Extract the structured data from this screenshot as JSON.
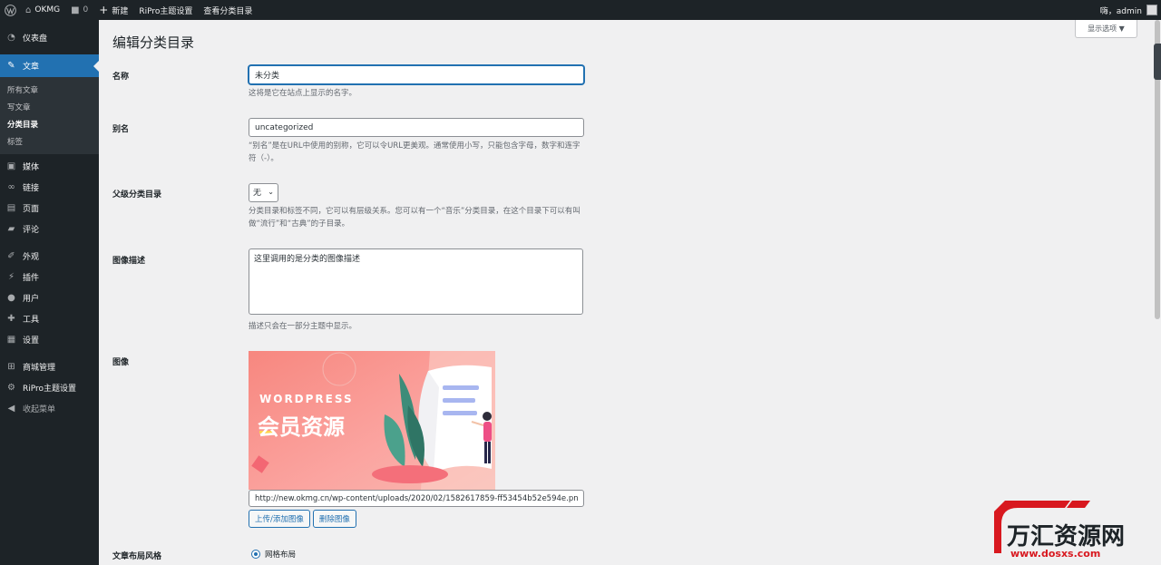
{
  "adminbar": {
    "site_name": "OKMG",
    "comments_count": "0",
    "new_label": "新建",
    "ripro_label": "RiPro主题设置",
    "view_label": "查看分类目录",
    "greeting": "嗨，admin"
  },
  "sidebar": {
    "dashboard": "仪表盘",
    "posts": "文章",
    "posts_sub": [
      "所有文章",
      "写文章",
      "分类目录",
      "标签"
    ],
    "media": "媒体",
    "links": "链接",
    "pages": "页面",
    "comments": "评论",
    "appearance": "外观",
    "plugins": "插件",
    "users": "用户",
    "tools": "工具",
    "settings": "设置",
    "shop": "商城管理",
    "ripro": "RiPro主题设置",
    "collapse": "收起菜单"
  },
  "main": {
    "screen_options": "显示选项 ▼",
    "title": "编辑分类目录",
    "name_label": "名称",
    "name_value": "未分类",
    "name_desc": "这将是它在站点上显示的名字。",
    "slug_label": "别名",
    "slug_value": "uncategorized",
    "slug_desc": "“别名”是在URL中使用的别称，它可以令URL更美观。通常使用小写，只能包含字母，数字和连字符（-）。",
    "parent_label": "父级分类目录",
    "parent_value": "无",
    "parent_desc": "分类目录和标签不同，它可以有层级关系。您可以有一个“音乐”分类目录，在这个目录下可以有叫做“流行”和“古典”的子目录。",
    "imgdesc_label": "图像描述",
    "imgdesc_value": "这里调用的是分类的图像描述",
    "imgdesc_desc": "描述只会在一部分主题中显示。",
    "image_label": "图像",
    "banner_text1": "WORDPRESS",
    "banner_text2": "会员资源",
    "image_url": "http://new.okmg.cn/wp-content/uploads/2020/02/1582617859-ff53454b52e594e.png",
    "upload_btn": "上传/添加图像",
    "delete_btn": "删除图像",
    "layout_label": "文章布局风格",
    "layout_option": "网格布局"
  },
  "watermark": {
    "brand": "万汇资源网",
    "url": "www.dosxs.com"
  },
  "colors": {
    "accent": "#2271b1",
    "sidebar_bg": "#1d2327",
    "banner_bg": "#f7877f"
  }
}
